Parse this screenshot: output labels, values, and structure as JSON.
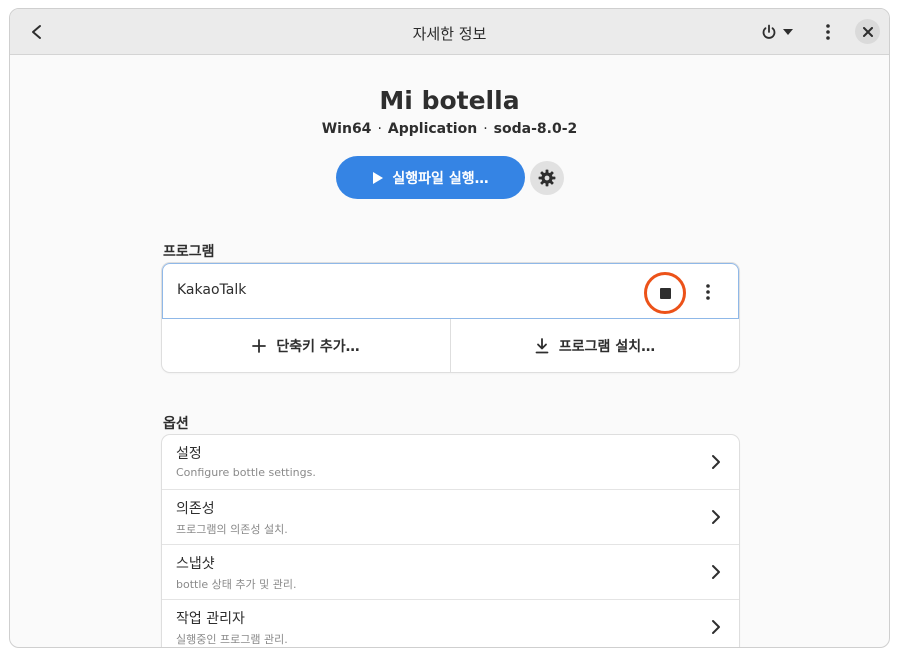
{
  "header": {
    "title": "자세한 정보",
    "back_icon": "back-arrow-icon",
    "power_icon": "power-icon",
    "menu_icon": "kebab-menu-icon",
    "close_icon": "close-icon"
  },
  "bottle": {
    "name": "Mi botella",
    "arch": "Win64",
    "env": "Application",
    "runner": "soda-8.0-2",
    "separator": "·"
  },
  "run_button": {
    "label": "실행파일 실행…",
    "icon": "play-icon"
  },
  "settings_button": {
    "icon": "gear-icon"
  },
  "programs_section": {
    "title": "프로그램",
    "items": [
      {
        "name": "KakaoTalk",
        "state": "running"
      }
    ],
    "actions": [
      {
        "label": "단축키 추가…",
        "icon": "plus-icon"
      },
      {
        "label": "프로그램 설치…",
        "icon": "download-icon"
      }
    ]
  },
  "options_section": {
    "title": "옵션",
    "rows": [
      {
        "title": "설정",
        "subtitle": "Configure bottle settings."
      },
      {
        "title": "의존성",
        "subtitle": "프로그램의 의존성 설치."
      },
      {
        "title": "스냅샷",
        "subtitle": "bottle 상태 추가 및 관리."
      },
      {
        "title": "작업 관리자",
        "subtitle": "실행중인 프로그램 관리."
      }
    ]
  },
  "colors": {
    "accent": "#3584e4",
    "highlight_ring": "#ec5219",
    "focus_border": "#8fb8e8"
  }
}
